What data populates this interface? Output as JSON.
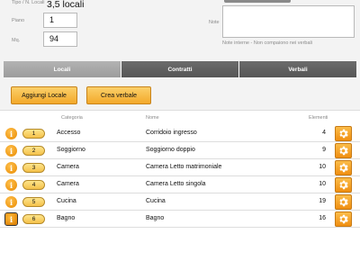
{
  "form": {
    "tipo_label": "Tipo / N. Locali",
    "tipo_value": "3,5 locali",
    "piano_label": "Piano",
    "piano_value": "1",
    "mq_label": "Mq.",
    "mq_value": "94",
    "note_label": "Note",
    "note_value": "",
    "note_hint": "Note interne - Non compaiono nei verbali"
  },
  "tabs": [
    {
      "label": "Locali",
      "active": true
    },
    {
      "label": "Contratti",
      "active": false
    },
    {
      "label": "Verbali",
      "active": false
    }
  ],
  "actions": {
    "add_label": "Aggiungi Locale",
    "report_label": "Crea verbale"
  },
  "table": {
    "headers": {
      "categoria": "Categoria",
      "nome": "Nome",
      "elementi": "Elementi"
    },
    "rows": [
      {
        "num": "1",
        "categoria": "Accesso",
        "nome": "Corridoio ingresso",
        "elementi": "4"
      },
      {
        "num": "2",
        "categoria": "Soggiorno",
        "nome": "Soggiorno doppio",
        "elementi": "9"
      },
      {
        "num": "3",
        "categoria": "Camera",
        "nome": "Camera Letto matrimoniale",
        "elementi": "10"
      },
      {
        "num": "4",
        "categoria": "Camera",
        "nome": "Camera Letto singola",
        "elementi": "10"
      },
      {
        "num": "5",
        "categoria": "Cucina",
        "nome": "Cucina",
        "elementi": "19"
      },
      {
        "num": "6",
        "categoria": "Bagno",
        "nome": "Bagno",
        "elementi": "16"
      }
    ]
  },
  "icons": {
    "info": "info-icon",
    "settings": "gear-icon"
  },
  "colors": {
    "accent": "#f3a92a",
    "tab_active": "#a8a8a8",
    "tab_inactive": "#5e5e5e"
  }
}
